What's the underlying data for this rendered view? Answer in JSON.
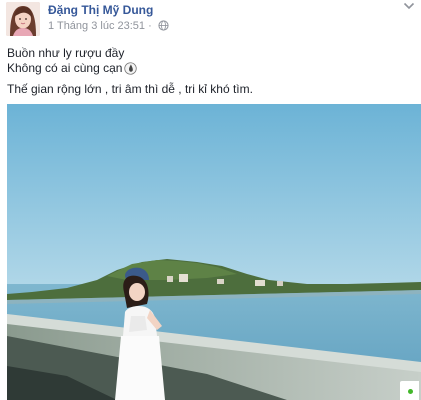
{
  "post": {
    "author": "Đặng Thị Mỹ Dung",
    "timestamp": "1 Tháng 3 lúc 23:51",
    "audience_separator": "·",
    "audience_icon": "globe-icon",
    "menu_icon": "chevron-down-icon",
    "caption_lines": [
      "Buồn như ly rượu đầy",
      "Không có ai cùng cạn",
      "Thế gian rộng lớn , tri âm thì dễ , tri kỉ khó tìm."
    ],
    "caption_emoji": "droplet-icon",
    "photo_description_icon": "seaside-photo"
  },
  "colors": {
    "author_link": "#365899",
    "meta_text": "#90949c",
    "online_status": "#42b72a"
  }
}
